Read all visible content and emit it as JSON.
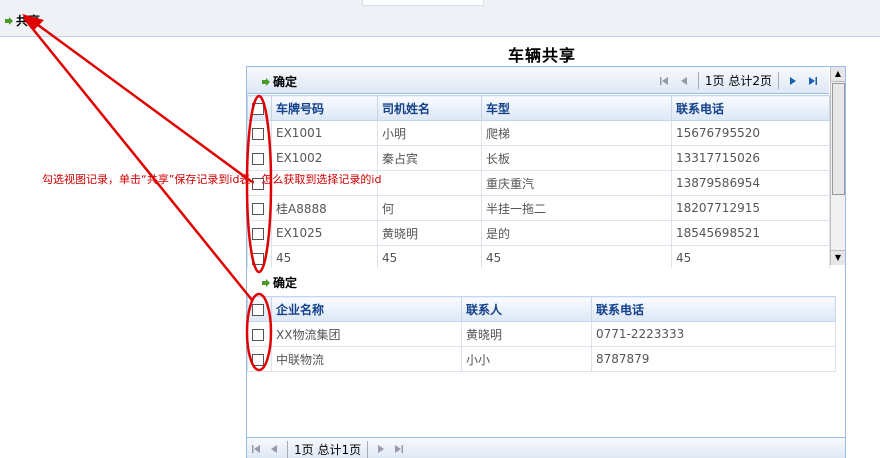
{
  "topbar": {
    "share_label": "共享"
  },
  "page_title": "车辆共享",
  "vehicle_panel": {
    "confirm_label": "确定",
    "pager_text": "1页 总计2页",
    "columns": [
      "车牌号码",
      "司机姓名",
      "车型",
      "联系电话"
    ],
    "rows": [
      [
        "EX1001",
        "小明",
        "爬梯",
        "15676795520"
      ],
      [
        "EX1002",
        "秦占宾",
        "长板",
        "13317715026"
      ],
      [
        "",
        "",
        "重庆重汽",
        "13879586954"
      ],
      [
        "桂A8888",
        "何",
        "半挂一拖二",
        "18207712915"
      ],
      [
        "EX1025",
        "黄晓明",
        "是的",
        "18545698521"
      ],
      [
        "45",
        "45",
        "45",
        "45"
      ]
    ]
  },
  "company_panel": {
    "confirm_label": "确定",
    "columns": [
      "企业名称",
      "联系人",
      "联系电话"
    ],
    "rows": [
      [
        "XX物流集团",
        "黄晓明",
        "0771-2223333"
      ],
      [
        "中联物流",
        "小小",
        "8787879"
      ]
    ],
    "pager_text": "1页 总计1页"
  },
  "annotation_text": "勾选视图记录，单击“共享”保存记录到id表，怎么获取到选择记录的id",
  "colors": {
    "annotation": "#d00000",
    "header_text": "#15428b",
    "border": "#99bbe8"
  }
}
